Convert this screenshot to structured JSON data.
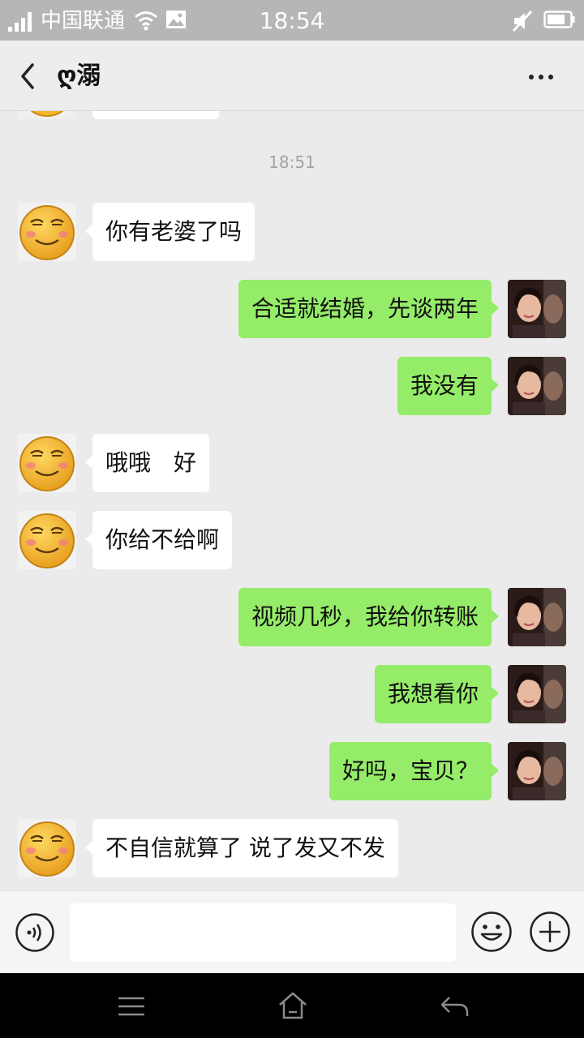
{
  "status_bar": {
    "carrier": "中国联通",
    "time": "18:54",
    "icons": [
      "signal-icon",
      "wifi-icon",
      "gallery-icon",
      "mute-icon",
      "battery-icon"
    ]
  },
  "header": {
    "title": "ღ溺",
    "back_icon": "chevron-left-icon",
    "more_icon": "more-dots-icon"
  },
  "chat": {
    "timestamp": "18:51",
    "messages": [
      {
        "side": "left",
        "text": "你有老婆了吗"
      },
      {
        "side": "right",
        "text": "合适就结婚，先谈两年"
      },
      {
        "side": "right",
        "text": "我没有"
      },
      {
        "side": "left",
        "text": "哦哦　好"
      },
      {
        "side": "left",
        "text": "你给不给啊"
      },
      {
        "side": "right",
        "text": "视频几秒，我给你转账"
      },
      {
        "side": "right",
        "text": "我想看你"
      },
      {
        "side": "right",
        "text": "好吗，宝贝？"
      },
      {
        "side": "left",
        "text": "不自信就算了 说了发又不发"
      }
    ]
  },
  "input_bar": {
    "value": "",
    "icons": [
      "voice-icon",
      "emoji-icon",
      "plus-icon"
    ]
  },
  "nav_bar": {
    "icons": [
      "menu-icon",
      "home-icon",
      "back-arrow-icon"
    ]
  },
  "colors": {
    "sent_bubble": "#95ec69",
    "received_bubble": "#ffffff",
    "chat_background": "#ebebeb",
    "status_bar": "#b6b6b6"
  }
}
